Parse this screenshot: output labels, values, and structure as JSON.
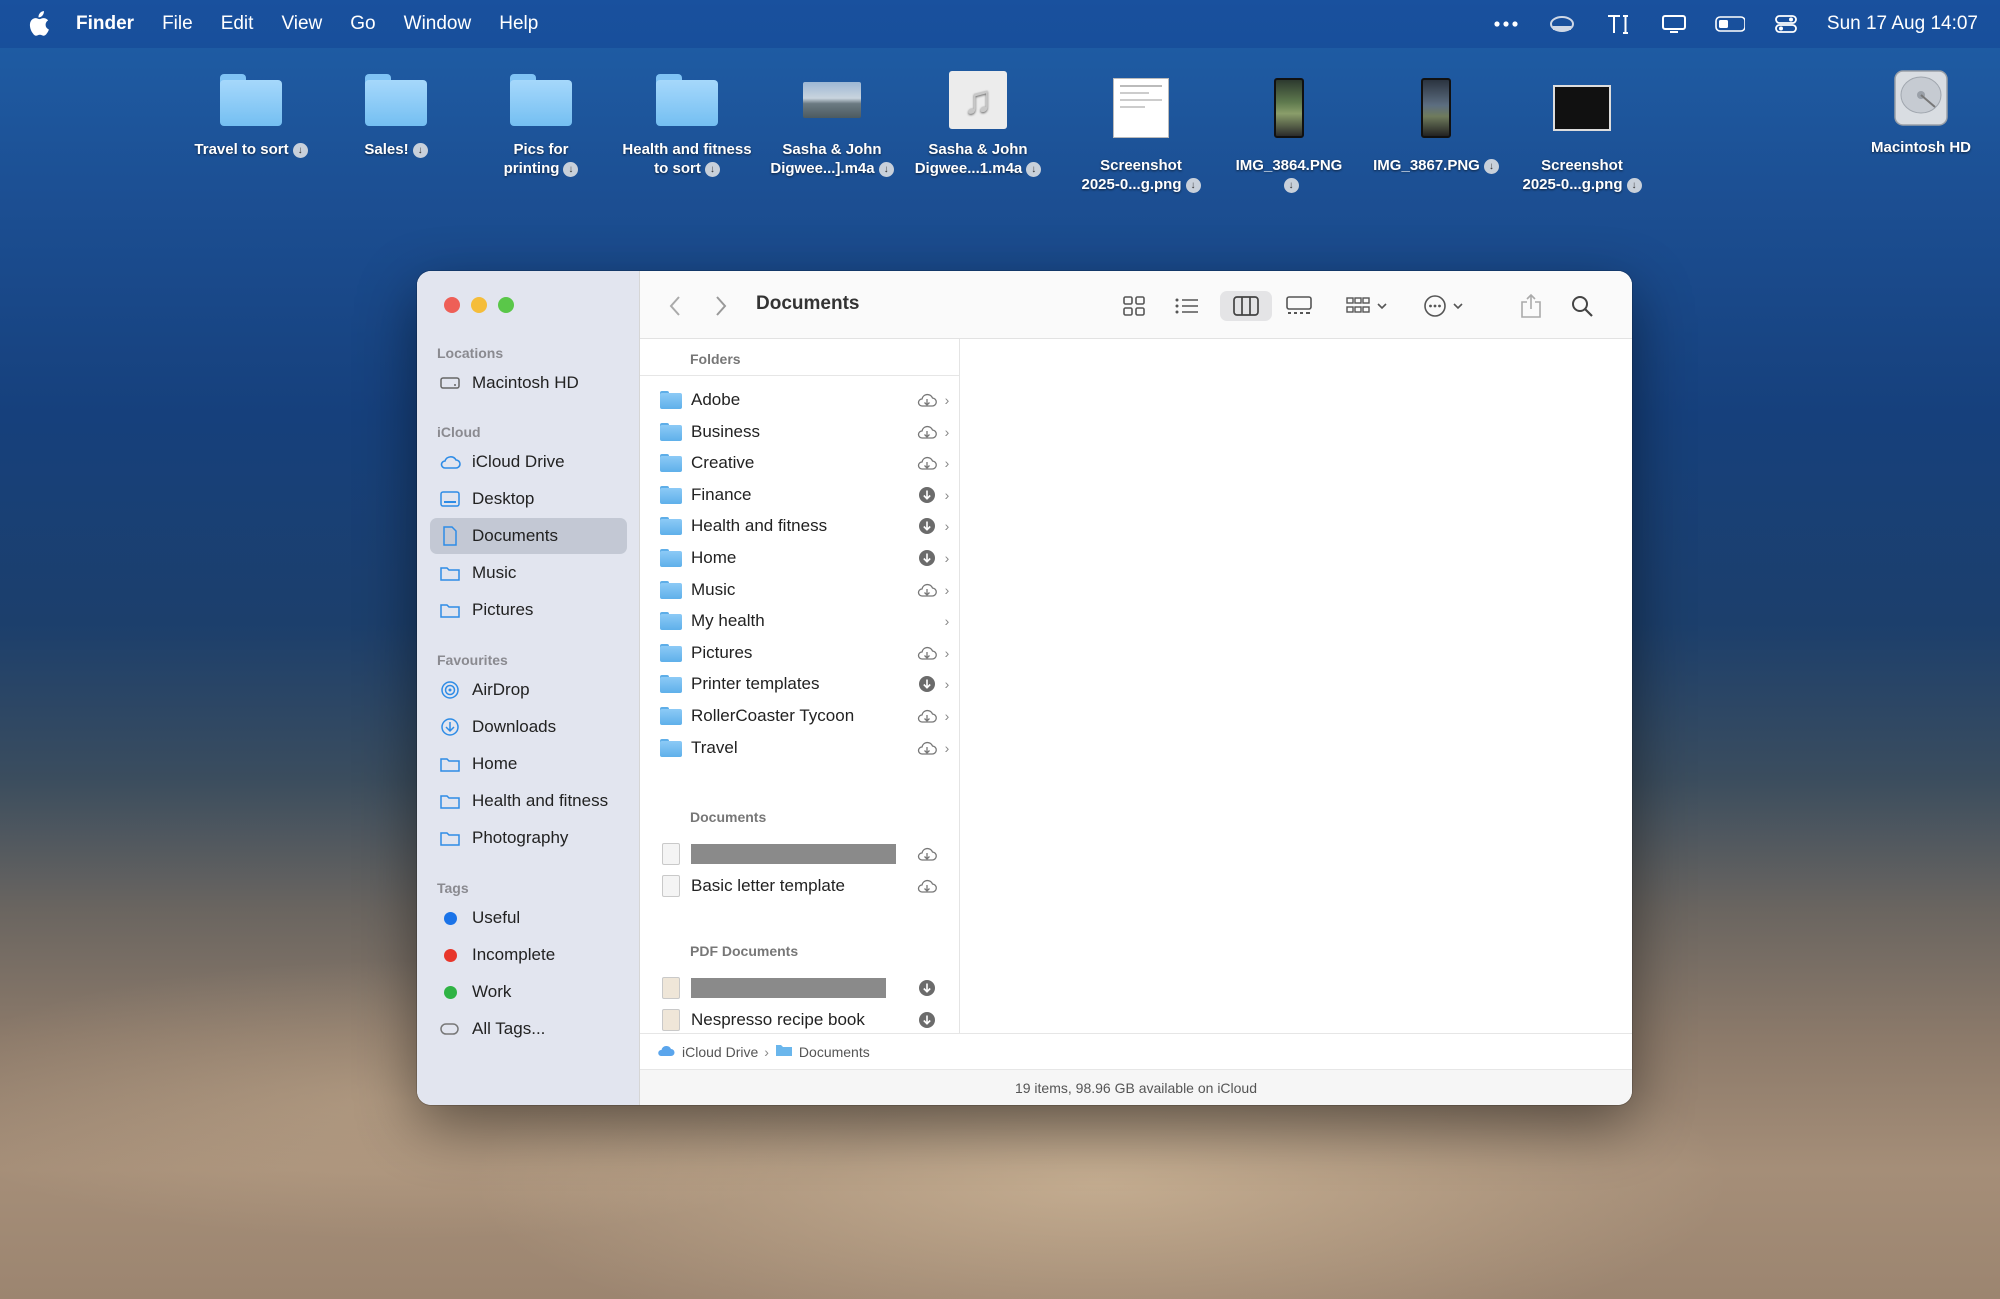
{
  "menubar": {
    "app_name": "Finder",
    "items": [
      "File",
      "Edit",
      "View",
      "Go",
      "Window",
      "Help"
    ],
    "clock": "Sun 17 Aug  14:07"
  },
  "desktop": {
    "items": [
      {
        "label1": "Travel to sort",
        "label2": "",
        "kind": "folder"
      },
      {
        "label1": "Sales!",
        "label2": "",
        "kind": "folder"
      },
      {
        "label1": "Pics for",
        "label2": "printing",
        "kind": "folder"
      },
      {
        "label1": "Health and fitness",
        "label2": "to sort",
        "kind": "folder"
      },
      {
        "label1": "Sasha & John",
        "label2": "Digwee...].m4a",
        "kind": "photo"
      },
      {
        "label1": "Sasha & John",
        "label2": "Digwee...1.m4a",
        "kind": "music"
      },
      {
        "label1": "Screenshot",
        "label2": "2025-0...g.png",
        "kind": "doc"
      },
      {
        "label1": "IMG_3864.PNG",
        "label2": "",
        "kind": "phone"
      },
      {
        "label1": "IMG_3867.PNG",
        "label2": "",
        "kind": "phone"
      },
      {
        "label1": "Screenshot",
        "label2": "2025-0...g.png",
        "kind": "dark"
      }
    ],
    "drive_label": "Macintosh HD"
  },
  "sidebar": {
    "locations_header": "Locations",
    "locations": [
      "Macintosh HD"
    ],
    "icloud_header": "iCloud",
    "icloud": [
      "iCloud Drive",
      "Desktop",
      "Documents",
      "Music",
      "Pictures"
    ],
    "favourites_header": "Favourites",
    "favourites": [
      "AirDrop",
      "Downloads",
      "Home",
      "Health and fitness",
      "Photography"
    ],
    "tags_header": "Tags",
    "tags": [
      {
        "label": "Useful",
        "color": "#1a73e8"
      },
      {
        "label": "Incomplete",
        "color": "#e8362b"
      },
      {
        "label": "Work",
        "color": "#2fb344"
      },
      {
        "label": "All Tags...",
        "color": ""
      }
    ]
  },
  "toolbar": {
    "title": "Documents"
  },
  "column": {
    "folders_header": "Folders",
    "folders": [
      {
        "name": "Adobe",
        "status": "cloud"
      },
      {
        "name": "Business",
        "status": "cloud"
      },
      {
        "name": "Creative",
        "status": "cloud"
      },
      {
        "name": "Finance",
        "status": "download"
      },
      {
        "name": "Health and fitness",
        "status": "download"
      },
      {
        "name": "Home",
        "status": "download"
      },
      {
        "name": "Music",
        "status": "cloud"
      },
      {
        "name": "My health",
        "status": "none"
      },
      {
        "name": "Pictures",
        "status": "cloud"
      },
      {
        "name": "Printer templates",
        "status": "download"
      },
      {
        "name": "RollerCoaster Tycoon",
        "status": "cloud"
      },
      {
        "name": "Travel",
        "status": "cloud"
      }
    ],
    "documents_header": "Documents",
    "documents": [
      "",
      "Basic letter template"
    ],
    "pdf_header": "PDF Documents",
    "pdfs": [
      "",
      "Nespresso recipe book"
    ]
  },
  "pathbar": {
    "root": "iCloud Drive",
    "current": "Documents"
  },
  "statusbar": {
    "text": "19 items, 98.96 GB available on iCloud"
  }
}
